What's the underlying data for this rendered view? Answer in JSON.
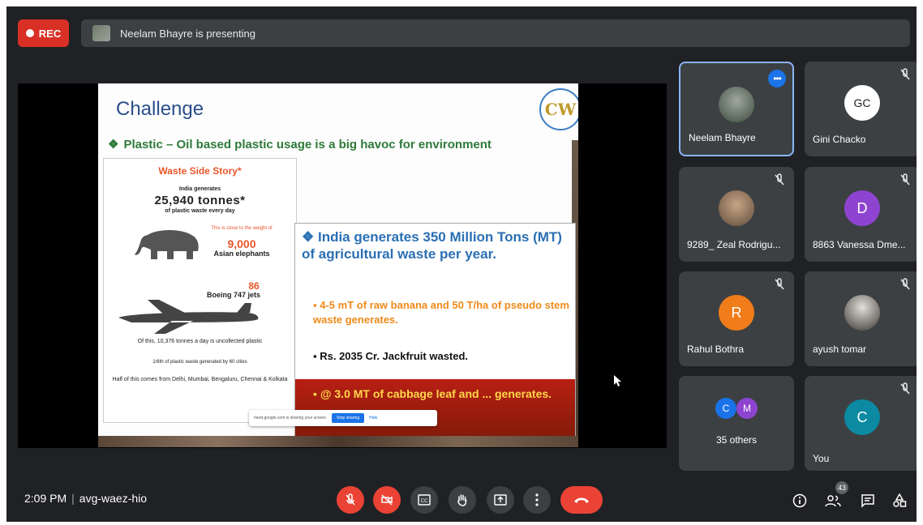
{
  "recording": {
    "label": "REC"
  },
  "presentation_bar": {
    "text": "Neelam Bhayre is presenting"
  },
  "slide": {
    "title": "Challenge",
    "subtitle": "Plastic – Oil based plastic usage is a big havoc for environment",
    "infographic": {
      "heading": "Waste Side Story*",
      "line1": "India generates",
      "tonnes": "25,940 tonnes*",
      "line2": "of plastic waste every day",
      "weight_note": "This is close to the weight of",
      "elephants_count": "9,000",
      "elephants_label": "Asian elephants",
      "jets_count": "86",
      "jets_label": "Boeing 747 jets",
      "uncollected": "Of this, 10,376 tonnes a day is uncollected plastic",
      "sixth": "1/6th of plastic waste generated by 60 cities",
      "half": "Half of this comes from Delhi, Mumbai, Bengaluru, Chennai & Kolkata"
    },
    "points": {
      "main": "India generates 350 Million Tons (MT) of agricultural waste per year.",
      "banana": "4-5 mT of raw banana and 50 T/ha of pseudo stem waste generates.",
      "jackfruit": "Rs. 2035 Cr. Jackfruit wasted.",
      "cabbage": "@ 3.0 MT of cabbage leaf and ... generates."
    },
    "share_banner": {
      "text": "meet.google.com is sharing your screen.",
      "stop": "Stop sharing",
      "hide": "Hide"
    }
  },
  "participants": [
    {
      "name": "Neelam Bhayre",
      "avatar": "photo",
      "active": true
    },
    {
      "name": "Gini Chacko",
      "initials": "GC",
      "color": "#ffffff",
      "muted": true
    },
    {
      "name": "9289_ Zeal Rodrigu...",
      "avatar": "photo",
      "muted": true
    },
    {
      "name": "8863 Vanessa Dme...",
      "initials": "D",
      "color": "#8e44d1",
      "muted": true
    },
    {
      "name": "Rahul Bothra",
      "initials": "R",
      "color": "#f07c1a",
      "muted": true
    },
    {
      "name": "ayush tomar",
      "avatar": "photo",
      "muted": true
    },
    {
      "name": "35 others",
      "initials": [
        "C",
        "M"
      ],
      "colors": [
        "#1a73e8",
        "#8e44d1"
      ]
    },
    {
      "name": "You",
      "initials": "C",
      "color": "#0c8aa3",
      "muted": true
    }
  ],
  "bottom_bar": {
    "time": "2:09 PM",
    "meeting_code": "avg-waez-hio",
    "participant_count": "43",
    "controls": [
      "mic-off-icon",
      "camera-off-icon",
      "captions-icon",
      "raise-hand-icon",
      "present-icon",
      "more-options-icon",
      "hang-up-icon"
    ],
    "right_icons": [
      "info-icon",
      "people-icon",
      "chat-icon",
      "activities-icon"
    ]
  },
  "colors": {
    "background": "#202124",
    "tile": "#3c4043",
    "accent": "#1a73e8",
    "danger": "#ea4335"
  }
}
